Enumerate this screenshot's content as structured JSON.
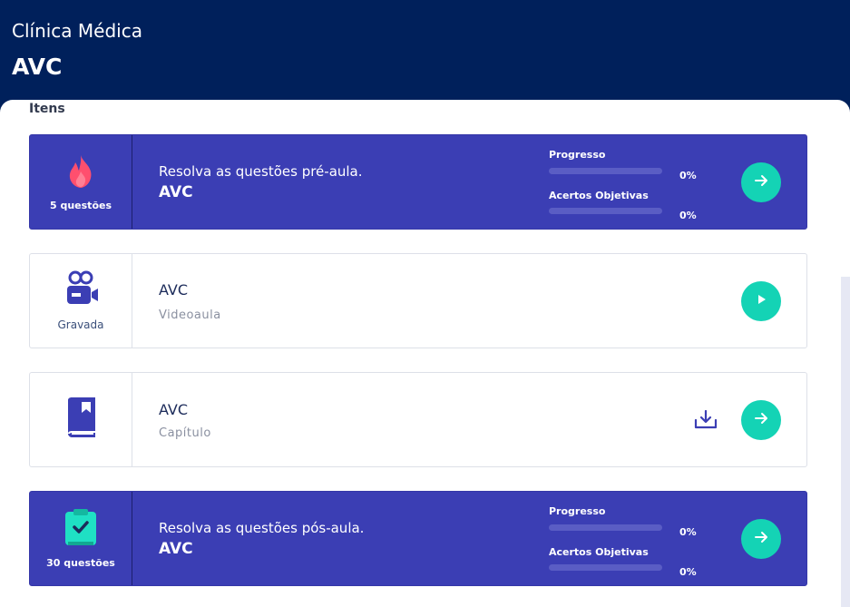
{
  "header": {
    "subject": "Clínica Médica",
    "topic": "AVC"
  },
  "section_title": "Itens",
  "colors": {
    "header_bg": "#00205b",
    "quiz_card_bg": "#3b3eb4",
    "action_button": "#14d3b5",
    "icon_accent": "#3b3eb4"
  },
  "items": [
    {
      "type": "pre-quiz",
      "icon": "fire-icon",
      "left_label": "5 questões",
      "title_line1": "Resolva as questões pré-aula.",
      "title_line2": "AVC",
      "progress_label": "Progresso",
      "progress_value": "0%",
      "progress_fraction": 0,
      "accuracy_label": "Acertos Objetivas",
      "accuracy_value": "0%",
      "accuracy_fraction": 0,
      "action_icon": "arrow-right-icon"
    },
    {
      "type": "video",
      "icon": "video-camera-icon",
      "left_label": "Gravada",
      "title": "AVC",
      "subtitle": "Videoaula",
      "action_icon": "play-icon"
    },
    {
      "type": "chapter",
      "icon": "book-icon",
      "title": "AVC",
      "subtitle": "Capítulo",
      "download_icon": "download-icon",
      "action_icon": "arrow-right-icon"
    },
    {
      "type": "post-quiz",
      "icon": "clipboard-check-icon",
      "left_label": "30 questões",
      "title_line1": "Resolva as questões pós-aula.",
      "title_line2": "AVC",
      "progress_label": "Progresso",
      "progress_value": "0%",
      "progress_fraction": 0,
      "accuracy_label": "Acertos Objetivas",
      "accuracy_value": "0%",
      "accuracy_fraction": 0,
      "action_icon": "arrow-right-icon"
    }
  ]
}
